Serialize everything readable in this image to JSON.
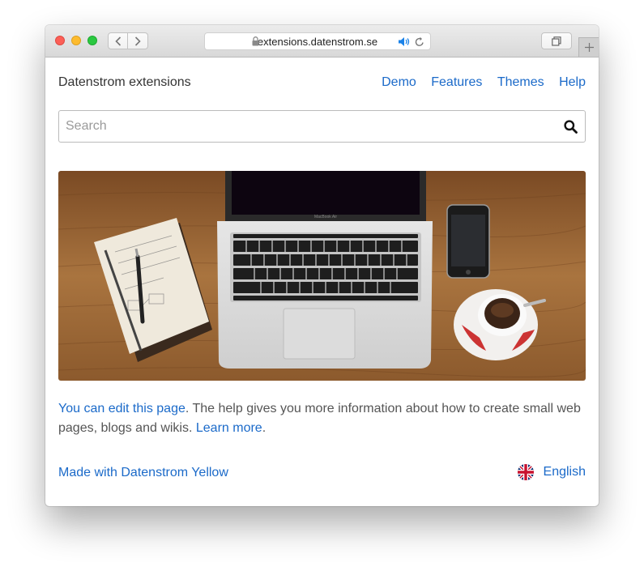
{
  "browser": {
    "url": "extensions.datenstrom.se"
  },
  "site": {
    "title": "Datenstrom extensions",
    "nav": [
      "Demo",
      "Features",
      "Themes",
      "Help"
    ]
  },
  "search": {
    "placeholder": "Search",
    "value": ""
  },
  "hero": {
    "laptop_brand": "MacBook Air"
  },
  "intro": {
    "edit_link": "You can edit this page",
    "text": ". The help gives you more information about how to create small web pages, blogs and wikis. ",
    "learn_more": "Learn more",
    "end": "."
  },
  "footer": {
    "made_with": "Made with Datenstrom Yellow",
    "language": "English"
  },
  "colors": {
    "link": "#1b6ac9",
    "text": "#555555"
  }
}
